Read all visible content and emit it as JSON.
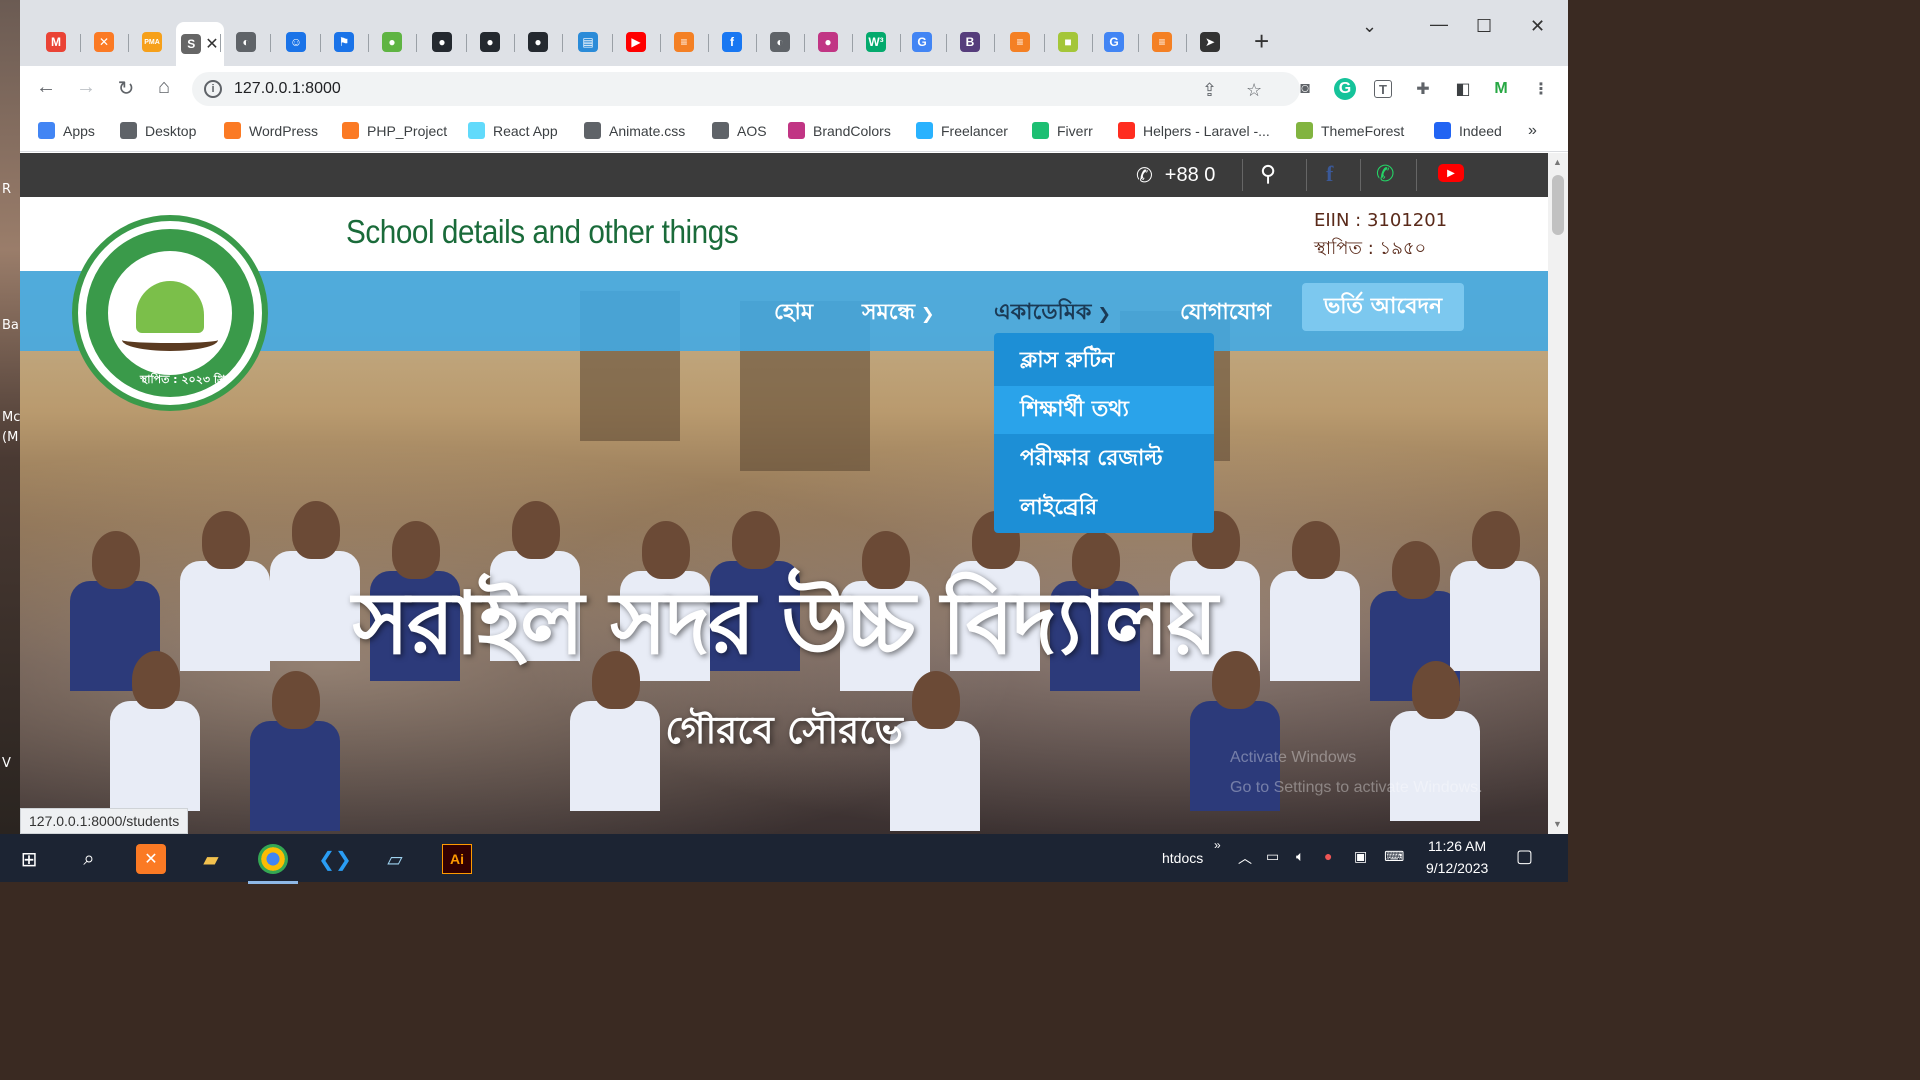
{
  "desktop": {
    "side_letters": [
      "R",
      "Ba",
      "Mc",
      "(M",
      "V"
    ]
  },
  "browser": {
    "tabs": [
      {
        "icon": "gmail-icon",
        "glyph": "M",
        "color": "#ea4335"
      },
      {
        "icon": "xampp-icon",
        "glyph": "✕",
        "color": "#fb7a24"
      },
      {
        "icon": "phpmyadmin-icon",
        "glyph": "PMA",
        "color": "#f6a01a"
      },
      {
        "icon": "page-icon",
        "glyph": "S",
        "color": "#666666"
      },
      {
        "icon": "globe-icon",
        "glyph": "◐",
        "color": "#5f6368"
      },
      {
        "icon": "smiley-icon",
        "glyph": "☺",
        "color": "#1a73e8"
      },
      {
        "icon": "flag-icon",
        "glyph": "⚑",
        "color": "#1a73e8"
      },
      {
        "icon": "leaf-icon",
        "glyph": "●",
        "color": "#5fb443"
      },
      {
        "icon": "github-icon",
        "glyph": "●",
        "color": "#24292f"
      },
      {
        "icon": "github-icon",
        "glyph": "●",
        "color": "#24292f"
      },
      {
        "icon": "github-icon",
        "glyph": "●",
        "color": "#24292f"
      },
      {
        "icon": "chart-icon",
        "glyph": "▤",
        "color": "#2a8bd8"
      },
      {
        "icon": "youtube-icon",
        "glyph": "▶",
        "color": "#ff0000"
      },
      {
        "icon": "stackoverflow-icon",
        "glyph": "≡",
        "color": "#f48024"
      },
      {
        "icon": "facebook-icon",
        "glyph": "f",
        "color": "#1877f2"
      },
      {
        "icon": "globe-icon",
        "glyph": "◐",
        "color": "#5f6368"
      },
      {
        "icon": "brandcolors-icon",
        "glyph": "●",
        "color": "#c13584"
      },
      {
        "icon": "w3schools-icon",
        "glyph": "W³",
        "color": "#04aa6d"
      },
      {
        "icon": "google-icon",
        "glyph": "G",
        "color": "#4285f4"
      },
      {
        "icon": "bootstrap-icon",
        "glyph": "B",
        "color": "#563d7c"
      },
      {
        "icon": "stackoverflow-icon",
        "glyph": "≡",
        "color": "#f48024"
      },
      {
        "icon": "android-icon",
        "glyph": "■",
        "color": "#a4c639"
      },
      {
        "icon": "translate-icon",
        "glyph": "G",
        "color": "#4285f4"
      },
      {
        "icon": "stackoverflow-icon",
        "glyph": "≡",
        "color": "#f48024"
      },
      {
        "icon": "send-icon",
        "glyph": "➤",
        "color": "#333333"
      }
    ],
    "active_tab_index": 3,
    "address": "127.0.0.1:8000",
    "bookmarks": [
      {
        "label": "Apps",
        "icon": "apps-grid-icon",
        "color": "#4285f4"
      },
      {
        "label": "Desktop",
        "icon": "globe-icon",
        "color": "#5f6368"
      },
      {
        "label": "WordPress",
        "icon": "xampp-icon",
        "color": "#fb7a24"
      },
      {
        "label": "PHP_Project",
        "icon": "xampp-icon",
        "color": "#fb7a24"
      },
      {
        "label": "React App",
        "icon": "react-icon",
        "color": "#61dafb"
      },
      {
        "label": "Animate.css",
        "icon": "globe-icon",
        "color": "#5f6368"
      },
      {
        "label": "AOS",
        "icon": "globe-icon",
        "color": "#5f6368"
      },
      {
        "label": "BrandColors",
        "icon": "brandcolors-icon",
        "color": "#c13584"
      },
      {
        "label": "Freelancer",
        "icon": "freelancer-icon",
        "color": "#29b2fe"
      },
      {
        "label": "Fiverr",
        "icon": "fiverr-icon",
        "color": "#1dbf73"
      },
      {
        "label": "Helpers - Laravel -...",
        "icon": "laravel-icon",
        "color": "#ff2d20"
      },
      {
        "label": "ThemeForest",
        "icon": "themeforest-icon",
        "color": "#82b440"
      },
      {
        "label": "Indeed",
        "icon": "indeed-icon",
        "color": "#2164f3"
      }
    ],
    "bookmarks_more": "»",
    "status_url": "127.0.0.1:8000/students"
  },
  "site": {
    "topbar": {
      "phone": "+88 0"
    },
    "tagline": "School details and other things",
    "eiin": "EIIN : 3101201",
    "established": "স্থাপিত : ১৯৫০",
    "logo_text": "স্থাপিত : ২০২৩ খ্রি",
    "nav": {
      "home": "হোম",
      "about": "সমন্ধে",
      "academic": "একাডেমিক",
      "contact": "যোগাযোগ",
      "apply": "ভর্তি আবেদন"
    },
    "dropdown": [
      {
        "label": "ক্লাস রুটিন",
        "active": false
      },
      {
        "label": "শিক্ষার্থী তথ্য",
        "active": true
      },
      {
        "label": "পরীক্ষার রেজাল্ট",
        "active": false
      },
      {
        "label": "লাইব্রেরি",
        "active": false
      }
    ],
    "hero_title": "সরাইল সদর উচ্চ বিদ্যালয়",
    "hero_subtitle": "গৌরবে সৌরভে",
    "watermark_line1": "Activate Windows",
    "watermark_line2": "Go to Settings to activate Windows."
  },
  "taskbar": {
    "folder_label": "htdocs",
    "time": "11:26 AM",
    "date": "9/12/2023"
  }
}
